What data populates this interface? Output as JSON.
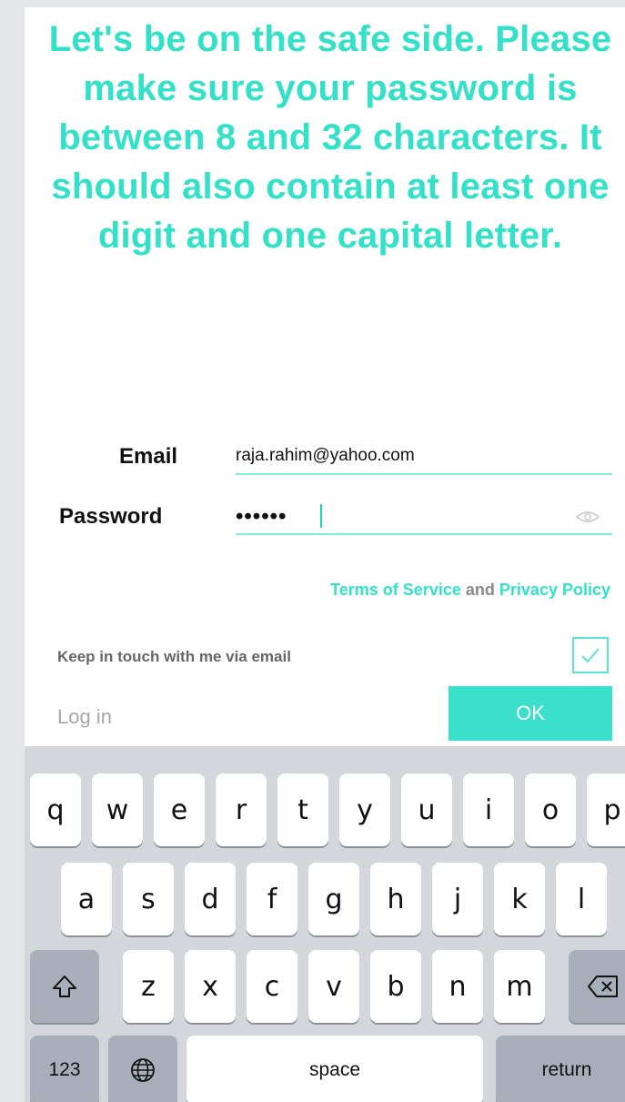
{
  "headline": "Let's be on the safe side. Please make sure your password is between 8 and 32 characters. It should also contain at least one digit and one capital letter.",
  "form": {
    "email_label": "Email",
    "email_value": "raja.rahim@yahoo.com",
    "password_label": "Password",
    "password_value": "••••••"
  },
  "legal": {
    "terms": "Terms of Service",
    "and": "and",
    "privacy": "Privacy Policy"
  },
  "keep_in_touch": {
    "label": "Keep in touch with me via email",
    "checked": true
  },
  "login_link": "Log in",
  "ok_button": "OK",
  "keyboard": {
    "row1": [
      "q",
      "w",
      "e",
      "r",
      "t",
      "y",
      "u",
      "i",
      "o",
      "p"
    ],
    "row2": [
      "a",
      "s",
      "d",
      "f",
      "g",
      "h",
      "j",
      "k",
      "l"
    ],
    "row3": [
      "z",
      "x",
      "c",
      "v",
      "b",
      "n",
      "m"
    ],
    "numbers_key": "123",
    "space_key": "space",
    "return_key": "return"
  },
  "colors": {
    "accent": "#33e0c8",
    "keyboard_bg": "#d3d6db"
  }
}
